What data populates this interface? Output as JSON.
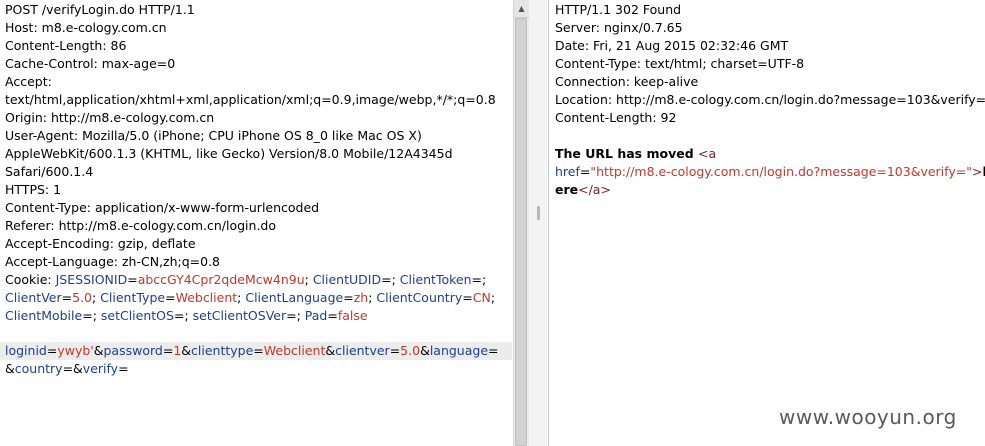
{
  "request": {
    "lines": [
      "POST /verifyLogin.do HTTP/1.1",
      "Host: m8.e-cology.com.cn",
      "Content-Length: 86",
      "Cache-Control: max-age=0",
      "Accept:",
      "text/html,application/xhtml+xml,application/xml;q=0.9,image/webp,*/*;q=0.8",
      "Origin: http://m8.e-cology.com.cn",
      "User-Agent: Mozilla/5.0 (iPhone; CPU iPhone OS 8_0 like Mac OS X)",
      "AppleWebKit/600.1.3 (KHTML, like Gecko) Version/8.0 Mobile/12A4345d",
      "Safari/600.1.4",
      "HTTPS: 1",
      "Content-Type: application/x-www-form-urlencoded",
      "Referer: http://m8.e-cology.com.cn/login.do",
      "Accept-Encoding: gzip, deflate",
      "Accept-Language: zh-CN,zh;q=0.8"
    ],
    "cookie": {
      "prefix": "Cookie: ",
      "line1": [
        {
          "k": "JSESSIONID",
          "v": "abccGY4Cpr2qdeMcw4n9u"
        },
        {
          "k": "ClientUDID",
          "v": ""
        },
        {
          "k": "ClientToken",
          "v": ""
        }
      ],
      "line2": [
        {
          "k": "ClientVer",
          "v": "5.0"
        },
        {
          "k": "ClientType",
          "v": "Webclient"
        },
        {
          "k": "ClientLanguage",
          "v": "zh"
        },
        {
          "k": "ClientCountry",
          "v": "CN"
        }
      ],
      "line3": [
        {
          "k": "ClientMobile",
          "v": ""
        },
        {
          "k": "setClientOS",
          "v": ""
        },
        {
          "k": "setClientOSVer",
          "v": ""
        },
        {
          "k": "Pad",
          "v": "false"
        }
      ]
    },
    "body": {
      "line1": [
        {
          "k": "loginid",
          "v": "ywyb'"
        },
        {
          "k": "password",
          "v": "1"
        },
        {
          "k": "clienttype",
          "v": "Webclient"
        },
        {
          "k": "clientver",
          "v": "5.0"
        },
        {
          "k": "language",
          "v": ""
        }
      ],
      "line2": [
        {
          "k": "country",
          "v": ""
        },
        {
          "k": "verify",
          "v": ""
        }
      ]
    }
  },
  "response": {
    "lines": [
      "HTTP/1.1 302 Found",
      "Server: nginx/0.7.65",
      "Date: Fri, 21 Aug 2015 02:32:46 GMT",
      "Content-Type: text/html; charset=UTF-8",
      "Connection: keep-alive",
      "Location: http://m8.e-cology.com.cn/login.do?message=103&verify=",
      "Content-Length: 92"
    ],
    "body_text": "The URL has moved ",
    "tag_open": "<a",
    "href_attr": "href",
    "href_eq": "=",
    "href_value": "\"http://m8.e-cology.com.cn/login.do?message=103&verify=\"",
    "tag_close_bracket": ">",
    "tail_char": "h",
    "line3_text": "ere",
    "tag_end": "</a>"
  },
  "watermark": "www.wooyun.org"
}
